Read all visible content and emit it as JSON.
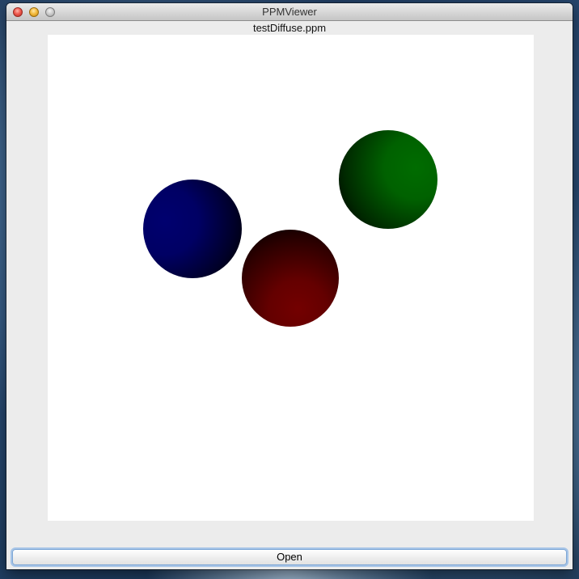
{
  "window": {
    "title": "PPMViewer",
    "controls": [
      "close-icon",
      "minimize-icon",
      "zoom-icon"
    ]
  },
  "viewer": {
    "file_name": "testDiffuse.ppm",
    "image": {
      "background": "#ffffff",
      "spheres": [
        {
          "name": "blue-sphere",
          "color": "#000064"
        },
        {
          "name": "red-sphere",
          "color": "#640000"
        },
        {
          "name": "green-sphere",
          "color": "#006100"
        }
      ]
    }
  },
  "actions": {
    "open_label": "Open"
  }
}
